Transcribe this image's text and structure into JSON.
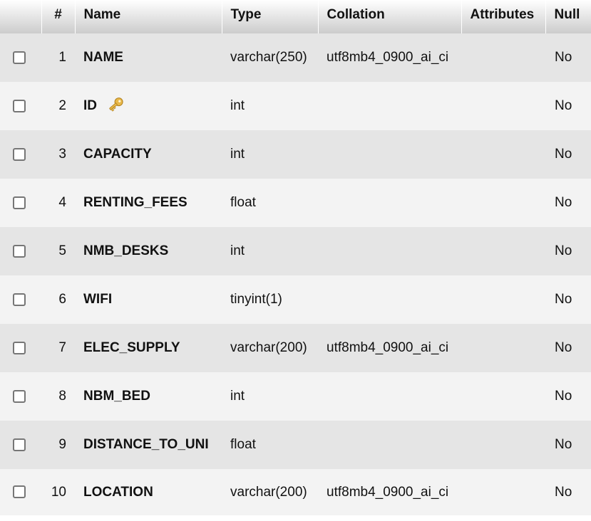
{
  "headers": {
    "num": "#",
    "name": "Name",
    "type": "Type",
    "collation": "Collation",
    "attributes": "Attributes",
    "null": "Null"
  },
  "rows": [
    {
      "num": "1",
      "name": "NAME",
      "type": "varchar(250)",
      "collation": "utf8mb4_0900_ai_ci",
      "attributes": "",
      "null": "No"
    },
    {
      "num": "2",
      "name": "ID",
      "type": "int",
      "collation": "",
      "attributes": "",
      "null": "No"
    },
    {
      "num": "3",
      "name": "CAPACITY",
      "type": "int",
      "collation": "",
      "attributes": "",
      "null": "No"
    },
    {
      "num": "4",
      "name": "RENTING_FEES",
      "type": "float",
      "collation": "",
      "attributes": "",
      "null": "No"
    },
    {
      "num": "5",
      "name": "NMB_DESKS",
      "type": "int",
      "collation": "",
      "attributes": "",
      "null": "No"
    },
    {
      "num": "6",
      "name": "WIFI",
      "type": "tinyint(1)",
      "collation": "",
      "attributes": "",
      "null": "No"
    },
    {
      "num": "7",
      "name": "ELEC_SUPPLY",
      "type": "varchar(200)",
      "collation": "utf8mb4_0900_ai_ci",
      "attributes": "",
      "null": "No"
    },
    {
      "num": "8",
      "name": "NBM_BED",
      "type": "int",
      "collation": "",
      "attributes": "",
      "null": "No"
    },
    {
      "num": "9",
      "name": "DISTANCE_TO_UNI",
      "type": "float",
      "collation": "",
      "attributes": "",
      "null": "No"
    },
    {
      "num": "10",
      "name": "LOCATION",
      "type": "varchar(200)",
      "collation": "utf8mb4_0900_ai_ci",
      "attributes": "",
      "null": "No"
    }
  ],
  "icons": {
    "primary_key": "key-icon"
  },
  "colors": {
    "header_gradient_top": "#ffffff",
    "header_gradient_bottom": "#cccccc",
    "row_odd": "#e5e5e5",
    "row_even": "#f3f3f3",
    "key_icon": "#e8b84a"
  }
}
